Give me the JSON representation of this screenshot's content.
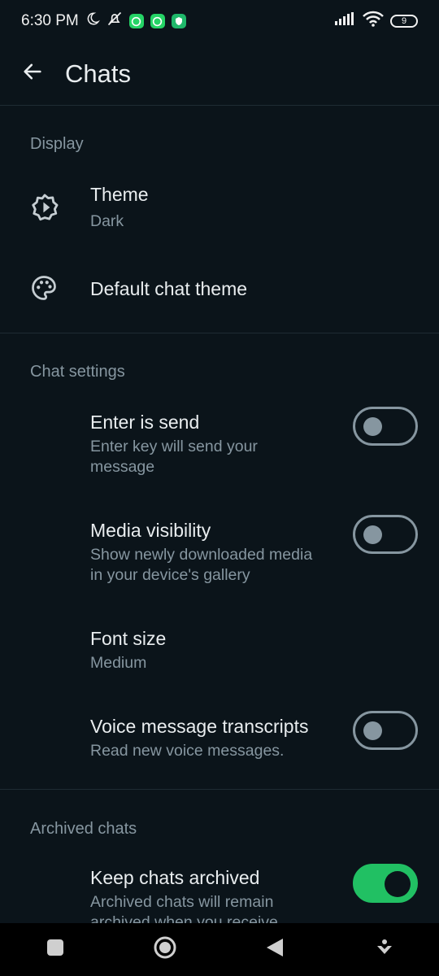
{
  "status_bar": {
    "time": "6:30 PM",
    "battery": "9",
    "icons": [
      "moon-icon",
      "mute-icon",
      "whatsapp-icon",
      "whatsapp-icon",
      "vpn-shield-icon",
      "signal-icon",
      "wifi-icon",
      "battery-icon"
    ]
  },
  "app_bar": {
    "title": "Chats",
    "back_icon": "arrow-left-icon"
  },
  "display": {
    "header": "Display",
    "theme": {
      "label": "Theme",
      "value": "Dark",
      "icon": "brightness-icon"
    },
    "default_chat_theme": {
      "label": "Default chat theme",
      "icon": "palette-icon"
    }
  },
  "chat_settings": {
    "header": "Chat settings",
    "enter_is_send": {
      "label": "Enter is send",
      "line1": "Enter key will send your",
      "line2": "message",
      "enabled": false
    },
    "media_visibility": {
      "label": "Media visibility",
      "line1": "Show newly downloaded media",
      "line2": "in your device's gallery",
      "enabled": false
    },
    "font_size": {
      "label": "Font size",
      "value": "Medium"
    },
    "voice_transcripts": {
      "label": "Voice message transcripts",
      "line1": "Read new voice messages.",
      "enabled": false
    }
  },
  "archived_chats": {
    "header": "Archived chats",
    "keep_archived": {
      "label": "Keep chats archived",
      "line1": "Archived chats will remain",
      "line2": "archived when you receive",
      "enabled": true
    }
  },
  "colors": {
    "accent": "#21c063",
    "background": "#0b141a",
    "secondary_text": "#8696a0"
  },
  "nav_bar": {
    "buttons": [
      "recents-square-icon",
      "home-circle-icon",
      "back-triangle-icon",
      "assist-icon"
    ]
  }
}
